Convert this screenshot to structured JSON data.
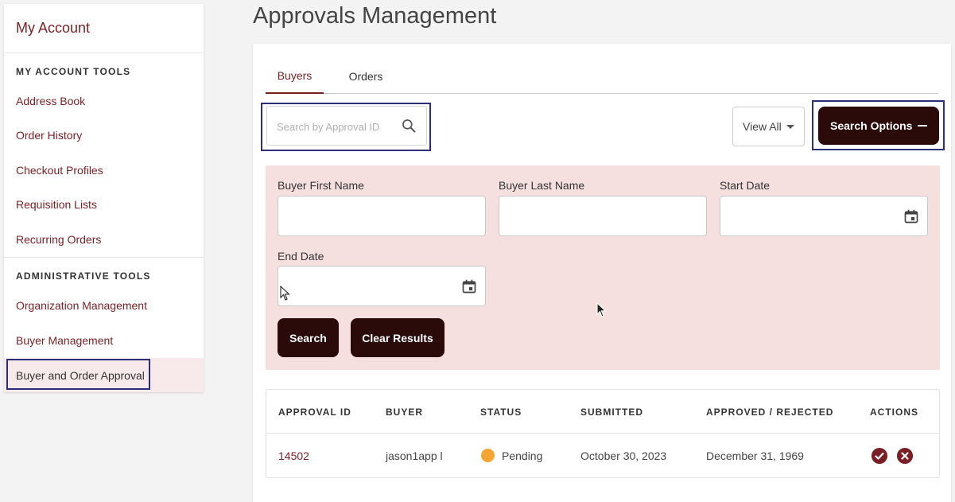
{
  "sidebar": {
    "title": "My Account",
    "sections": [
      {
        "heading": "MY ACCOUNT TOOLS",
        "items": [
          "Address Book",
          "Order History",
          "Checkout Profiles",
          "Requisition Lists",
          "Recurring Orders"
        ]
      },
      {
        "heading": "ADMINISTRATIVE TOOLS",
        "items": [
          "Organization Management",
          "Buyer Management",
          "Buyer and Order Approval"
        ]
      }
    ],
    "active_item": "Buyer and Order Approval"
  },
  "page": {
    "title": "Approvals Management"
  },
  "tabs": [
    {
      "label": "Buyers",
      "active": true
    },
    {
      "label": "Orders",
      "active": false
    }
  ],
  "search": {
    "placeholder": "Search by Approval ID",
    "value": ""
  },
  "view_filter": {
    "selected": "View All"
  },
  "search_options_button": "Search Options",
  "filters": {
    "buyer_first_name": {
      "label": "Buyer First Name",
      "value": ""
    },
    "buyer_last_name": {
      "label": "Buyer Last Name",
      "value": ""
    },
    "start_date": {
      "label": "Start Date",
      "value": ""
    },
    "end_date": {
      "label": "End Date",
      "value": ""
    },
    "search_button": "Search",
    "clear_button": "Clear Results"
  },
  "table": {
    "columns": [
      "APPROVAL ID",
      "BUYER",
      "STATUS",
      "SUBMITTED",
      "APPROVED / REJECTED",
      "ACTIONS"
    ],
    "rows": [
      {
        "approval_id": "14502",
        "buyer": "jason1app l",
        "status": "Pending",
        "submitted": "October 30, 2023",
        "approved_rejected": "December 31, 1969"
      }
    ]
  },
  "colors": {
    "brand": "#7a1f24",
    "dark_button": "#2b0a0a",
    "filter_panel": "#f6dfdf",
    "pending": "#f5a531",
    "highlight": "#2b2f7a"
  },
  "icons": [
    "search-icon",
    "chevron-down-icon",
    "minus-icon",
    "calendar-icon",
    "approve-check-icon",
    "reject-x-icon"
  ]
}
